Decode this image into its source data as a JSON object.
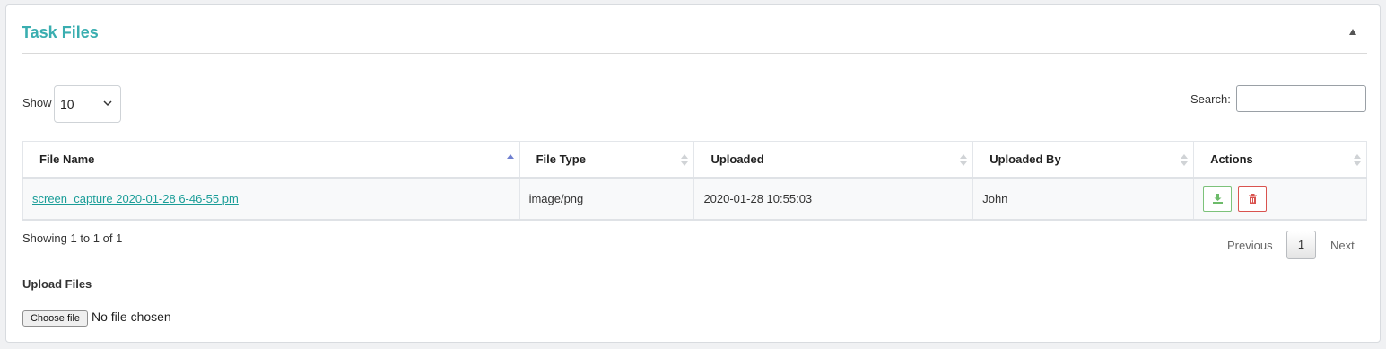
{
  "panel": {
    "title": "Task Files",
    "collapse_icon": "triangle-up-icon"
  },
  "controls": {
    "show_label": "Show",
    "page_length": "10",
    "search_label": "Search:",
    "search_value": ""
  },
  "table": {
    "columns": [
      {
        "label": "File Name",
        "sort": "asc"
      },
      {
        "label": "File Type",
        "sort": "none"
      },
      {
        "label": "Uploaded",
        "sort": "none"
      },
      {
        "label": "Uploaded By",
        "sort": "none"
      },
      {
        "label": "Actions",
        "sort": "none"
      }
    ],
    "rows": [
      {
        "file_name": "screen_capture 2020-01-28 6-46-55 pm",
        "file_type": "image/png",
        "uploaded": "2020-01-28 10:55:03",
        "uploaded_by": "John",
        "actions": [
          "download-icon",
          "trash-icon"
        ]
      }
    ]
  },
  "pagination": {
    "info": "Showing 1 to 1 of 1",
    "previous": "Previous",
    "current_page": "1",
    "next": "Next"
  },
  "upload": {
    "label": "Upload Files",
    "choose_button": "Choose file",
    "status": "No file chosen"
  },
  "colors": {
    "title": "#3aaeb0",
    "link": "#1a9d98",
    "download": "#7cc27a",
    "delete": "#d9534f",
    "sort_active": "#6f7fd0"
  }
}
